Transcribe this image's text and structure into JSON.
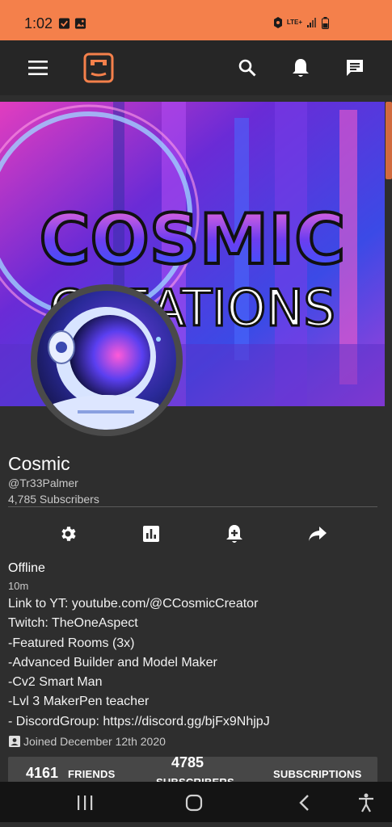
{
  "status_bar": {
    "time": "1:02",
    "network": "LTE+"
  },
  "profile": {
    "banner_title": "COSMIC",
    "banner_subtitle": "CREATIONS",
    "name": "Cosmic",
    "handle": "@Tr33Palmer",
    "subscribers_text": "4,785 Subscribers",
    "status": "Offline",
    "last_seen": "10m",
    "bio": [
      "Link to YT: youtube.com/@CCosmicCreator",
      "Twitch: TheOneAspect",
      "-Featured Rooms (3x)",
      "-Advanced Builder and Model Maker",
      "-Cv2 Smart Man",
      "-Lvl 3 MakerPen teacher",
      "- DiscordGroup: https://discord.gg/bjFx9NhjpJ"
    ],
    "joined": "Joined December 12th 2020"
  },
  "stats": {
    "friends_count": "4161",
    "friends_label": "FRIENDS",
    "subscribers_count": "4785",
    "subscribers_label": "SUBSCRIBERS",
    "subscriptions_label": "SUBSCRIPTIONS"
  },
  "colors": {
    "accent": "#f4804b",
    "background": "#2e2e2e",
    "toolbar": "#262626",
    "stats_bar": "#474747"
  },
  "icons": {
    "menu": "menu-icon",
    "logo": "rec-room-logo",
    "search": "search-icon",
    "notifications": "bell-icon",
    "messages": "chat-icon",
    "settings": "gear-icon",
    "stats": "bar-chart-icon",
    "subscribe": "bell-plus-icon",
    "share": "share-icon",
    "joined": "badge-icon"
  }
}
